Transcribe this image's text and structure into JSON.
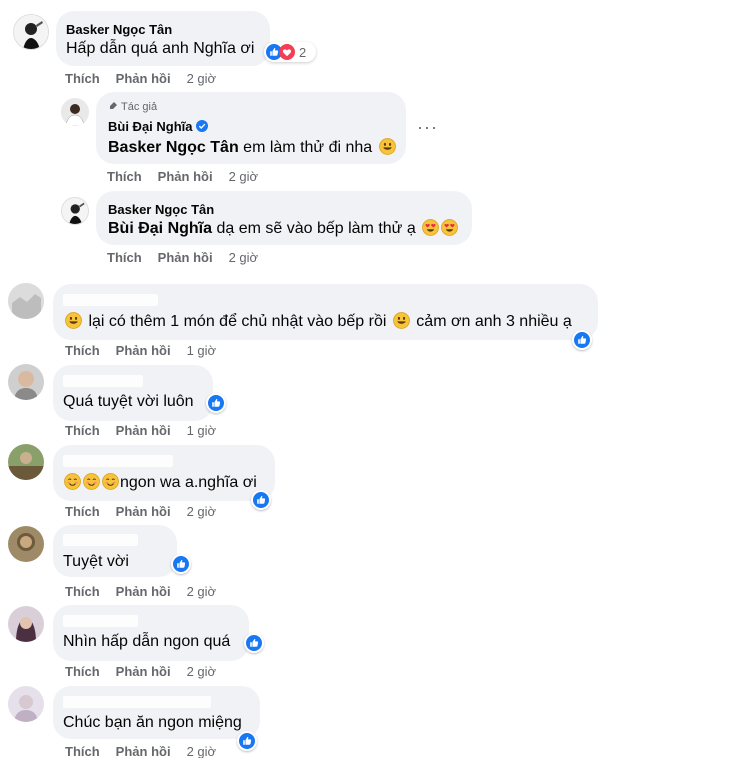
{
  "colors": {
    "bubble": "#f0f2f5",
    "like_blue": "#1877f2",
    "heart_red": "#f33e58",
    "meta": "#65676b"
  },
  "comments": [
    {
      "author": "Basker Ngọc Tân",
      "text": "Hấp dẫn quá anh Nghĩa ơi",
      "reaction_count": "2",
      "reactions": [
        "like-icon",
        "heart-icon"
      ],
      "actions": {
        "like": "Thích",
        "reply": "Phản hồi",
        "time": "2 giờ"
      }
    },
    {
      "author_tag": "Tác giả",
      "author": "Bùi Đại Nghĩa",
      "mention": "Basker Ngọc Tân",
      "text": " em làm thử đi nha",
      "more": "···",
      "actions": {
        "like": "Thích",
        "reply": "Phản hồi",
        "time": "2 giờ"
      }
    },
    {
      "author": "Basker Ngọc Tân",
      "mention": "Bùi Đại Nghĩa",
      "text": " dạ em sẽ vào bếp làm thử ạ",
      "actions": {
        "like": "Thích",
        "reply": "Phản hồi",
        "time": "2 giờ"
      }
    },
    {
      "text_a": " lại có thêm 1 món để chủ nhật vào bếp rồi ",
      "text_b": " cảm ơn anh 3 nhiều ạ",
      "actions": {
        "like": "Thích",
        "reply": "Phản hồi",
        "time": "1 giờ"
      }
    },
    {
      "text": "Quá tuyệt vời luôn",
      "actions": {
        "like": "Thích",
        "reply": "Phản hồi",
        "time": "1 giờ"
      }
    },
    {
      "text": "ngon wa a.nghĩa ơi",
      "actions": {
        "like": "Thích",
        "reply": "Phản hồi",
        "time": "2 giờ"
      }
    },
    {
      "text": "Tuyệt vời",
      "actions": {
        "like": "Thích",
        "reply": "Phản hồi",
        "time": "2 giờ"
      }
    },
    {
      "text": "Nhìn hấp dẫn ngon quá",
      "actions": {
        "like": "Thích",
        "reply": "Phản hồi",
        "time": "2 giờ"
      }
    },
    {
      "text": "Chúc bạn ăn ngon miệng",
      "actions": {
        "like": "Thích",
        "reply": "Phản hồi",
        "time": "2 giờ"
      }
    }
  ]
}
